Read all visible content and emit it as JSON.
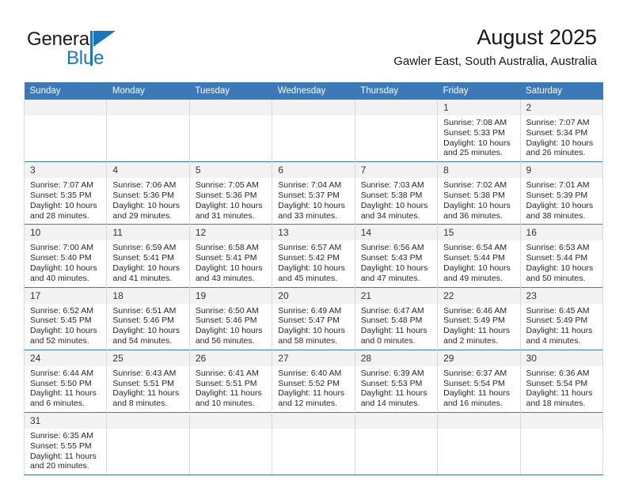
{
  "brand": {
    "name_part1": "General",
    "name_part2": "Blue",
    "accent_color": "#1b75bb"
  },
  "header": {
    "title": "August 2025",
    "subtitle": "Gawler East, South Australia, Australia"
  },
  "theme": {
    "header_row_color": "#3b79b8",
    "daynum_band_color": "#f2f2f2",
    "grid_line_color": "#3b79b8"
  },
  "weekday_headers": [
    "Sunday",
    "Monday",
    "Tuesday",
    "Wednesday",
    "Thursday",
    "Friday",
    "Saturday"
  ],
  "labels": {
    "sunrise_prefix": "Sunrise:",
    "sunset_prefix": "Sunset:",
    "daylight_prefix": "Daylight:"
  },
  "weeks": [
    [
      {
        "day": "",
        "empty": true
      },
      {
        "day": "",
        "empty": true
      },
      {
        "day": "",
        "empty": true
      },
      {
        "day": "",
        "empty": true
      },
      {
        "day": "",
        "empty": true
      },
      {
        "day": "1",
        "sunrise": "Sunrise: 7:08 AM",
        "sunset": "Sunset: 5:33 PM",
        "daylight1": "Daylight: 10 hours",
        "daylight2": "and 25 minutes."
      },
      {
        "day": "2",
        "sunrise": "Sunrise: 7:07 AM",
        "sunset": "Sunset: 5:34 PM",
        "daylight1": "Daylight: 10 hours",
        "daylight2": "and 26 minutes."
      }
    ],
    [
      {
        "day": "3",
        "sunrise": "Sunrise: 7:07 AM",
        "sunset": "Sunset: 5:35 PM",
        "daylight1": "Daylight: 10 hours",
        "daylight2": "and 28 minutes."
      },
      {
        "day": "4",
        "sunrise": "Sunrise: 7:06 AM",
        "sunset": "Sunset: 5:36 PM",
        "daylight1": "Daylight: 10 hours",
        "daylight2": "and 29 minutes."
      },
      {
        "day": "5",
        "sunrise": "Sunrise: 7:05 AM",
        "sunset": "Sunset: 5:36 PM",
        "daylight1": "Daylight: 10 hours",
        "daylight2": "and 31 minutes."
      },
      {
        "day": "6",
        "sunrise": "Sunrise: 7:04 AM",
        "sunset": "Sunset: 5:37 PM",
        "daylight1": "Daylight: 10 hours",
        "daylight2": "and 33 minutes."
      },
      {
        "day": "7",
        "sunrise": "Sunrise: 7:03 AM",
        "sunset": "Sunset: 5:38 PM",
        "daylight1": "Daylight: 10 hours",
        "daylight2": "and 34 minutes."
      },
      {
        "day": "8",
        "sunrise": "Sunrise: 7:02 AM",
        "sunset": "Sunset: 5:38 PM",
        "daylight1": "Daylight: 10 hours",
        "daylight2": "and 36 minutes."
      },
      {
        "day": "9",
        "sunrise": "Sunrise: 7:01 AM",
        "sunset": "Sunset: 5:39 PM",
        "daylight1": "Daylight: 10 hours",
        "daylight2": "and 38 minutes."
      }
    ],
    [
      {
        "day": "10",
        "sunrise": "Sunrise: 7:00 AM",
        "sunset": "Sunset: 5:40 PM",
        "daylight1": "Daylight: 10 hours",
        "daylight2": "and 40 minutes."
      },
      {
        "day": "11",
        "sunrise": "Sunrise: 6:59 AM",
        "sunset": "Sunset: 5:41 PM",
        "daylight1": "Daylight: 10 hours",
        "daylight2": "and 41 minutes."
      },
      {
        "day": "12",
        "sunrise": "Sunrise: 6:58 AM",
        "sunset": "Sunset: 5:41 PM",
        "daylight1": "Daylight: 10 hours",
        "daylight2": "and 43 minutes."
      },
      {
        "day": "13",
        "sunrise": "Sunrise: 6:57 AM",
        "sunset": "Sunset: 5:42 PM",
        "daylight1": "Daylight: 10 hours",
        "daylight2": "and 45 minutes."
      },
      {
        "day": "14",
        "sunrise": "Sunrise: 6:56 AM",
        "sunset": "Sunset: 5:43 PM",
        "daylight1": "Daylight: 10 hours",
        "daylight2": "and 47 minutes."
      },
      {
        "day": "15",
        "sunrise": "Sunrise: 6:54 AM",
        "sunset": "Sunset: 5:44 PM",
        "daylight1": "Daylight: 10 hours",
        "daylight2": "and 49 minutes."
      },
      {
        "day": "16",
        "sunrise": "Sunrise: 6:53 AM",
        "sunset": "Sunset: 5:44 PM",
        "daylight1": "Daylight: 10 hours",
        "daylight2": "and 50 minutes."
      }
    ],
    [
      {
        "day": "17",
        "sunrise": "Sunrise: 6:52 AM",
        "sunset": "Sunset: 5:45 PM",
        "daylight1": "Daylight: 10 hours",
        "daylight2": "and 52 minutes."
      },
      {
        "day": "18",
        "sunrise": "Sunrise: 6:51 AM",
        "sunset": "Sunset: 5:46 PM",
        "daylight1": "Daylight: 10 hours",
        "daylight2": "and 54 minutes."
      },
      {
        "day": "19",
        "sunrise": "Sunrise: 6:50 AM",
        "sunset": "Sunset: 5:46 PM",
        "daylight1": "Daylight: 10 hours",
        "daylight2": "and 56 minutes."
      },
      {
        "day": "20",
        "sunrise": "Sunrise: 6:49 AM",
        "sunset": "Sunset: 5:47 PM",
        "daylight1": "Daylight: 10 hours",
        "daylight2": "and 58 minutes."
      },
      {
        "day": "21",
        "sunrise": "Sunrise: 6:47 AM",
        "sunset": "Sunset: 5:48 PM",
        "daylight1": "Daylight: 11 hours",
        "daylight2": "and 0 minutes."
      },
      {
        "day": "22",
        "sunrise": "Sunrise: 6:46 AM",
        "sunset": "Sunset: 5:49 PM",
        "daylight1": "Daylight: 11 hours",
        "daylight2": "and 2 minutes."
      },
      {
        "day": "23",
        "sunrise": "Sunrise: 6:45 AM",
        "sunset": "Sunset: 5:49 PM",
        "daylight1": "Daylight: 11 hours",
        "daylight2": "and 4 minutes."
      }
    ],
    [
      {
        "day": "24",
        "sunrise": "Sunrise: 6:44 AM",
        "sunset": "Sunset: 5:50 PM",
        "daylight1": "Daylight: 11 hours",
        "daylight2": "and 6 minutes."
      },
      {
        "day": "25",
        "sunrise": "Sunrise: 6:43 AM",
        "sunset": "Sunset: 5:51 PM",
        "daylight1": "Daylight: 11 hours",
        "daylight2": "and 8 minutes."
      },
      {
        "day": "26",
        "sunrise": "Sunrise: 6:41 AM",
        "sunset": "Sunset: 5:51 PM",
        "daylight1": "Daylight: 11 hours",
        "daylight2": "and 10 minutes."
      },
      {
        "day": "27",
        "sunrise": "Sunrise: 6:40 AM",
        "sunset": "Sunset: 5:52 PM",
        "daylight1": "Daylight: 11 hours",
        "daylight2": "and 12 minutes."
      },
      {
        "day": "28",
        "sunrise": "Sunrise: 6:39 AM",
        "sunset": "Sunset: 5:53 PM",
        "daylight1": "Daylight: 11 hours",
        "daylight2": "and 14 minutes."
      },
      {
        "day": "29",
        "sunrise": "Sunrise: 6:37 AM",
        "sunset": "Sunset: 5:54 PM",
        "daylight1": "Daylight: 11 hours",
        "daylight2": "and 16 minutes."
      },
      {
        "day": "30",
        "sunrise": "Sunrise: 6:36 AM",
        "sunset": "Sunset: 5:54 PM",
        "daylight1": "Daylight: 11 hours",
        "daylight2": "and 18 minutes."
      }
    ],
    [
      {
        "day": "31",
        "sunrise": "Sunrise: 6:35 AM",
        "sunset": "Sunset: 5:55 PM",
        "daylight1": "Daylight: 11 hours",
        "daylight2": "and 20 minutes."
      },
      {
        "day": "",
        "empty": true
      },
      {
        "day": "",
        "empty": true
      },
      {
        "day": "",
        "empty": true
      },
      {
        "day": "",
        "empty": true
      },
      {
        "day": "",
        "empty": true
      },
      {
        "day": "",
        "empty": true
      }
    ]
  ]
}
